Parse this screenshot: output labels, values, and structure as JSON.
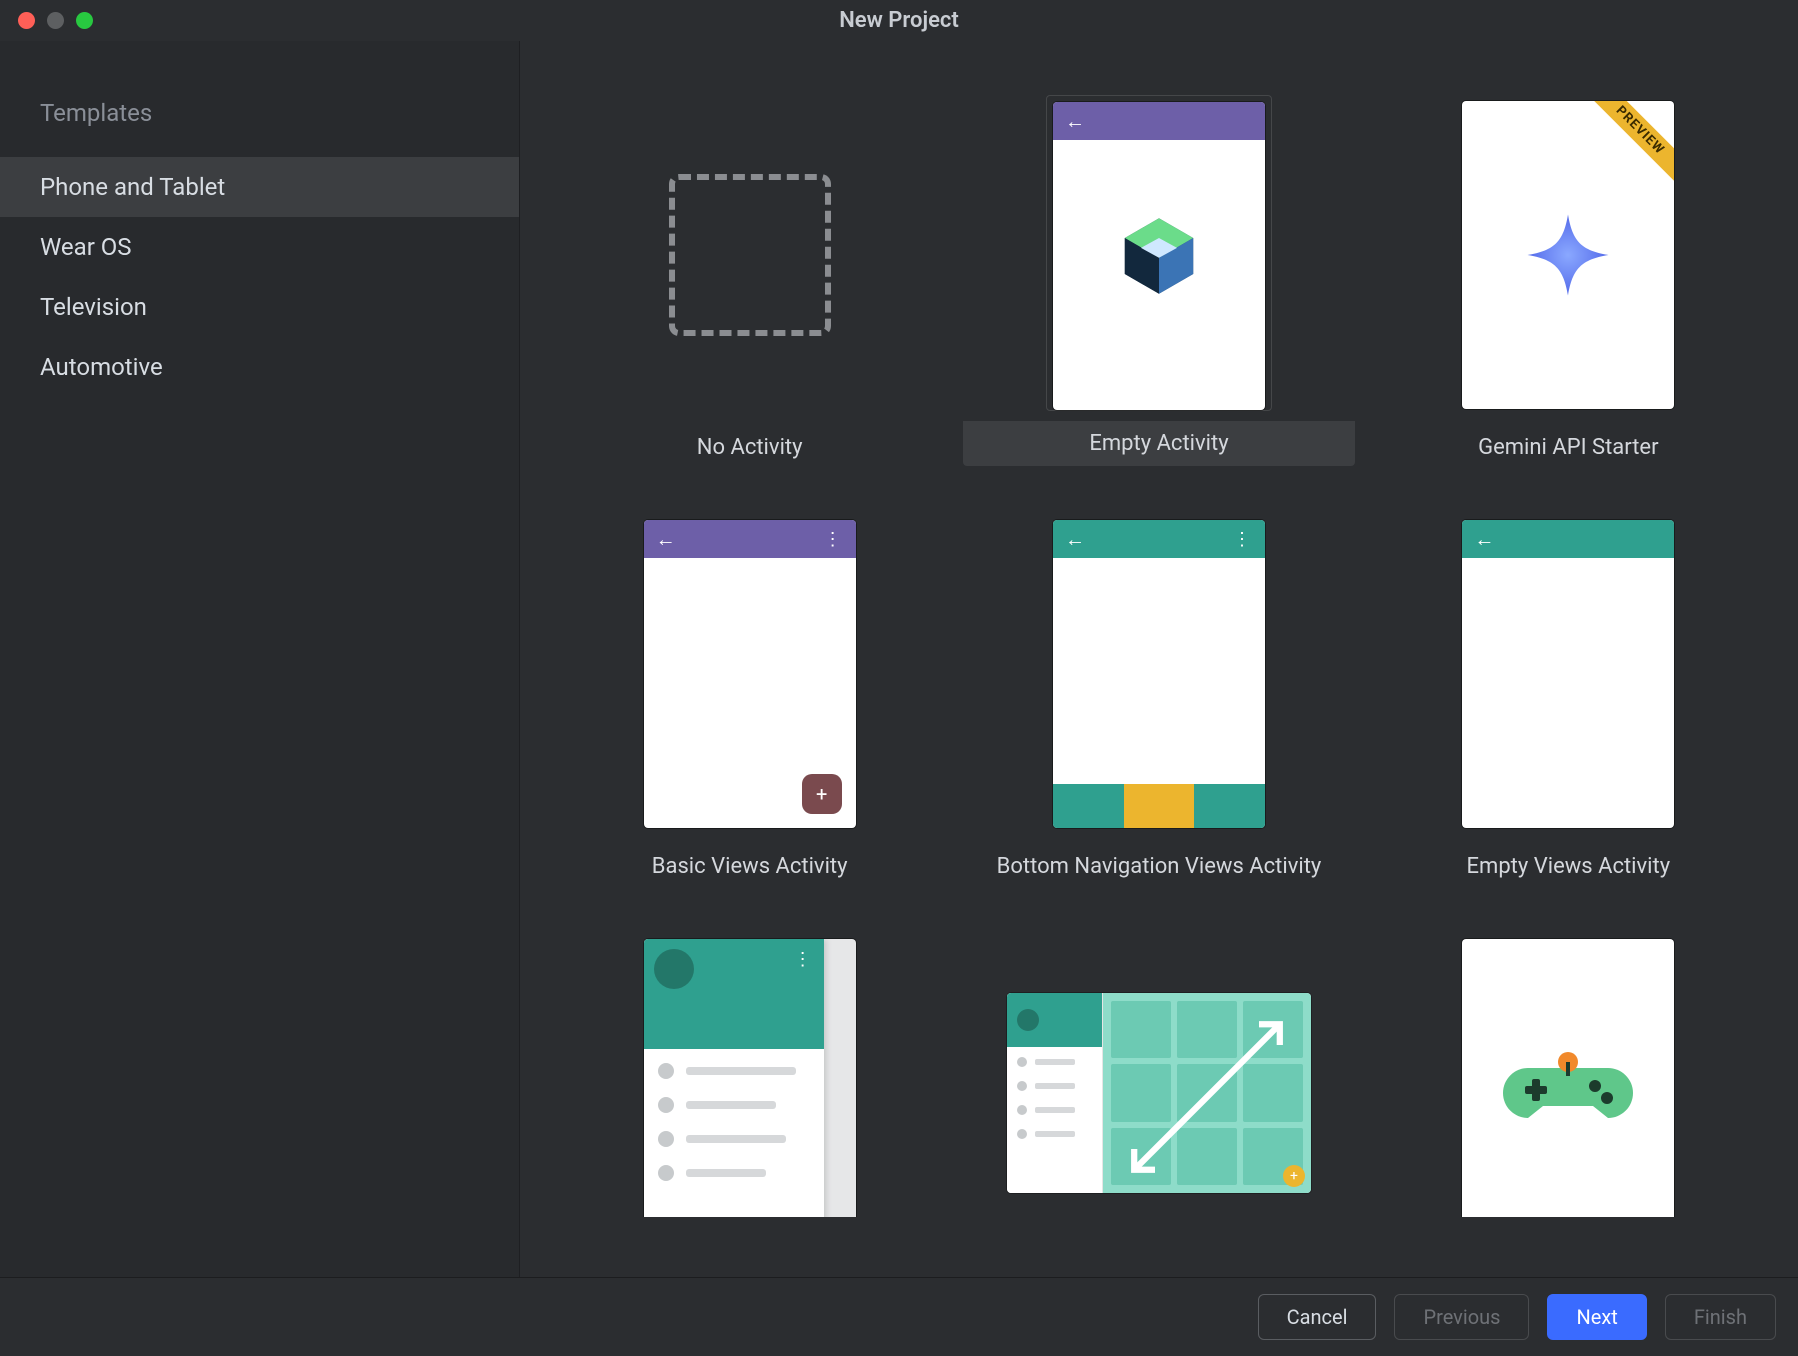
{
  "window": {
    "title": "New Project"
  },
  "sidebar": {
    "header": "Templates",
    "items": [
      {
        "label": "Phone and Tablet",
        "selected": true
      },
      {
        "label": "Wear OS"
      },
      {
        "label": "Television"
      },
      {
        "label": "Automotive"
      }
    ]
  },
  "templates": [
    {
      "id": "no-activity",
      "label": "No Activity"
    },
    {
      "id": "empty-activity",
      "label": "Empty Activity",
      "selected": true
    },
    {
      "id": "gemini-api-starter",
      "label": "Gemini API Starter",
      "ribbon": "PREVIEW"
    },
    {
      "id": "basic-views-activity",
      "label": "Basic Views Activity"
    },
    {
      "id": "bottom-nav-views-activity",
      "label": "Bottom Navigation Views Activity"
    },
    {
      "id": "empty-views-activity",
      "label": "Empty Views Activity"
    },
    {
      "id": "nav-drawer-views-activity",
      "label": ""
    },
    {
      "id": "responsive-views-activity",
      "label": ""
    },
    {
      "id": "game-activity",
      "label": ""
    }
  ],
  "footer": {
    "cancel": "Cancel",
    "previous": "Previous",
    "next": "Next",
    "finish": "Finish"
  },
  "colors": {
    "accent": "#3a6bff",
    "teal": "#2fa08f",
    "purple": "#6d5fa8",
    "yellow": "#ecb52e"
  }
}
